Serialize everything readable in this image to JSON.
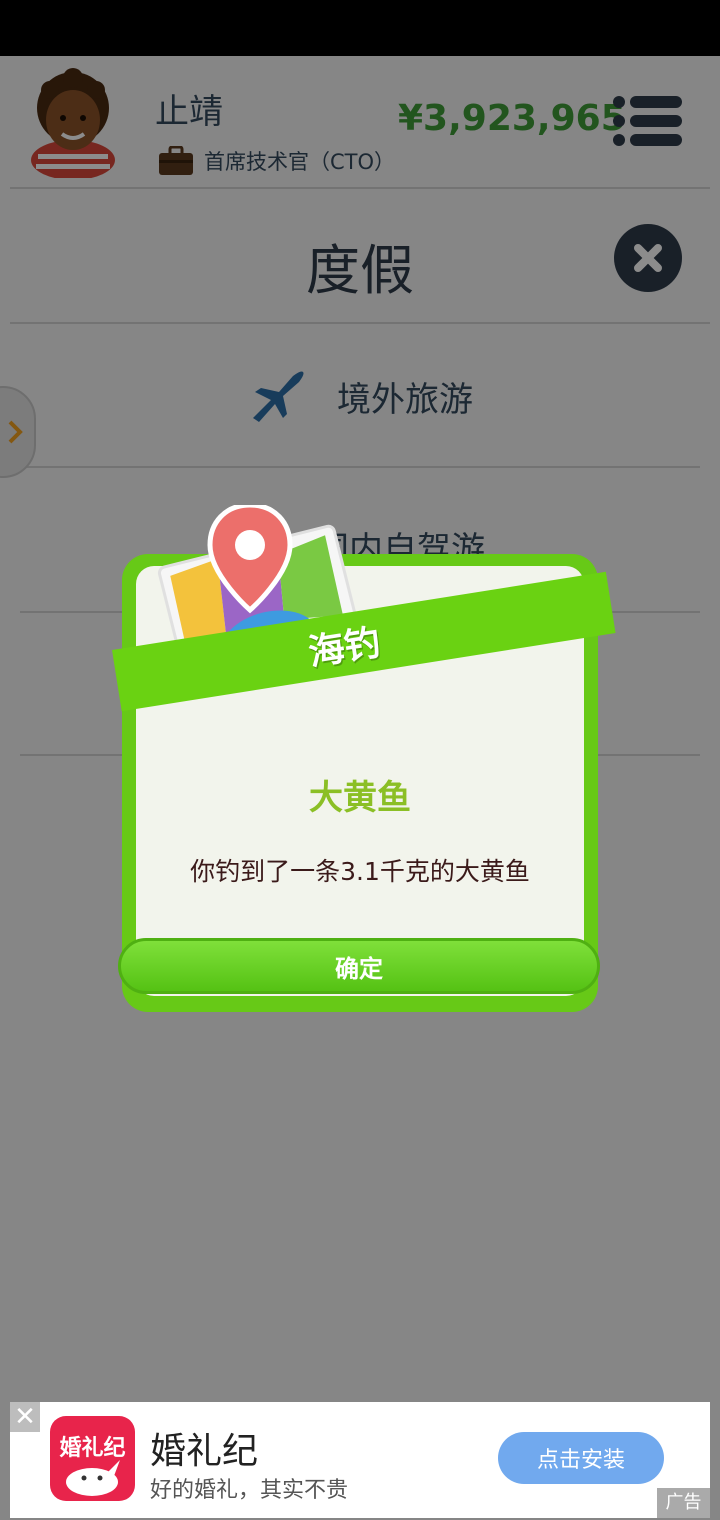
{
  "header": {
    "username": "止靖",
    "job_title": "首席技术官（CTO）",
    "money": "¥3,923,965",
    "icons": {
      "avatar": "avatar-icon",
      "briefcase": "briefcase-icon",
      "menu": "menu-icon"
    }
  },
  "page": {
    "title": "度假",
    "close_icon": "close-icon"
  },
  "vacation_items": [
    {
      "label": "境外旅游",
      "icon": "airplane-icon"
    },
    {
      "label": "国内自驾游",
      "icon": "car-icon"
    }
  ],
  "dialog": {
    "ribbon_title": "海钓",
    "catch_name": "大黄鱼",
    "catch_desc": "你钓到了一条3.1千克的大黄鱼",
    "confirm_label": "确定",
    "icon": "map-pin-icon"
  },
  "ad": {
    "logo_text": "婚礼纪",
    "title": "婚礼纪",
    "subtitle": "好的婚礼，其实不贵",
    "button_label": "点击安装",
    "tag": "广告",
    "close_symbol": "✕"
  },
  "colors": {
    "accent_green": "#67c917",
    "money_green": "#3e9b38",
    "dark_text": "#2f3b4a",
    "ad_button": "#71a9ee"
  }
}
